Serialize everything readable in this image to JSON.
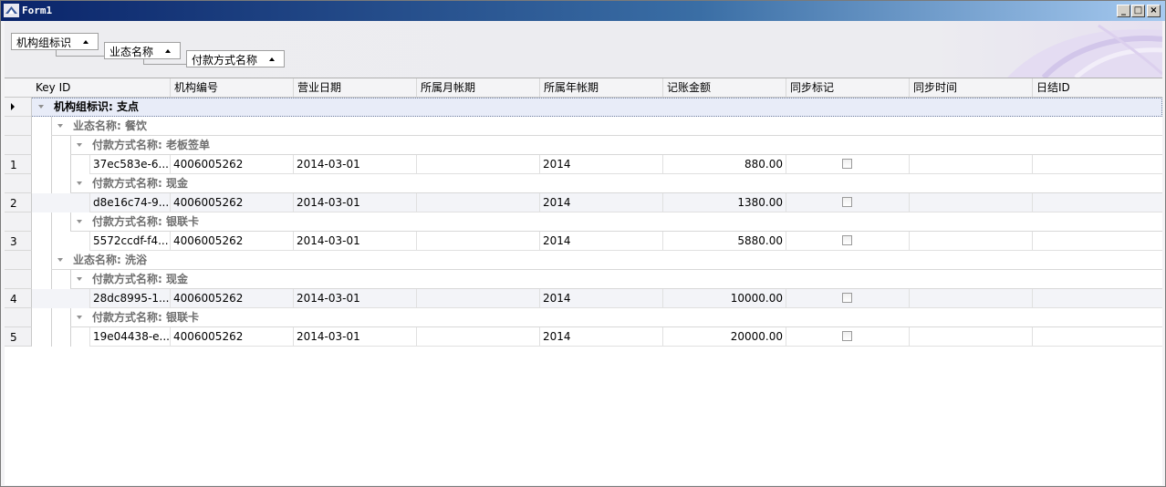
{
  "window": {
    "title": "Form1"
  },
  "group_panel": {
    "buttons": [
      "机构组标识",
      "业态名称",
      "付款方式名称"
    ]
  },
  "columns": [
    "Key ID",
    "机构编号",
    "营业日期",
    "所属月帐期",
    "所属年帐期",
    "记账金额",
    "同步标记",
    "同步时间",
    "日结ID"
  ],
  "groups": {
    "top": "机构组标识: 支点",
    "sub1": "业态名称: 餐饮",
    "sub2": "业态名称: 洗浴",
    "pay1": "付款方式名称: 老板签单",
    "pay2": "付款方式名称: 现金",
    "pay3": "付款方式名称: 银联卡",
    "pay4": "付款方式名称: 现金",
    "pay5": "付款方式名称: 银联卡"
  },
  "rows": [
    {
      "index": "1",
      "key_id": "37ec583e-6...",
      "org_no": "4006005262",
      "date": "2014-03-01",
      "month": "",
      "year": "2014",
      "amount": "880.00"
    },
    {
      "index": "2",
      "key_id": "d8e16c74-9...",
      "org_no": "4006005262",
      "date": "2014-03-01",
      "month": "",
      "year": "2014",
      "amount": "1380.00"
    },
    {
      "index": "3",
      "key_id": "5572ccdf-f4...",
      "org_no": "4006005262",
      "date": "2014-03-01",
      "month": "",
      "year": "2014",
      "amount": "5880.00"
    },
    {
      "index": "4",
      "key_id": "28dc8995-1...",
      "org_no": "4006005262",
      "date": "2014-03-01",
      "month": "",
      "year": "2014",
      "amount": "10000.00"
    },
    {
      "index": "5",
      "key_id": "19e04438-e...",
      "org_no": "4006005262",
      "date": "2014-03-01",
      "month": "",
      "year": "2014",
      "amount": "20000.00"
    }
  ],
  "colors": {
    "titlebar": "#0a246a",
    "focus_row": "#e8ecf8"
  }
}
